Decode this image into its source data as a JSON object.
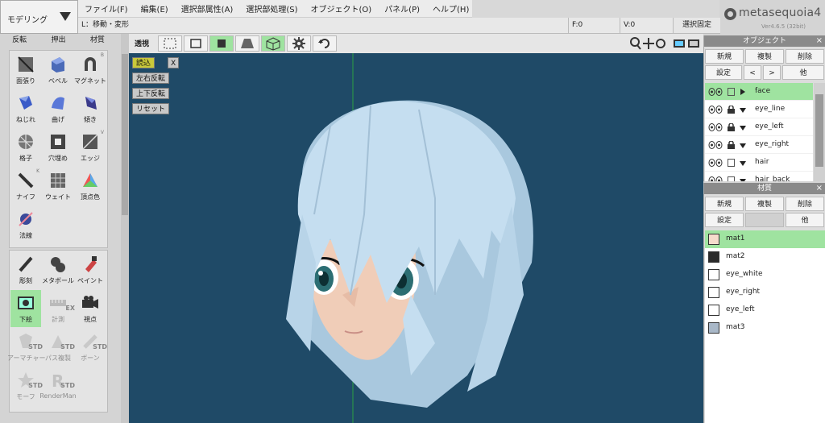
{
  "mode": {
    "label": "モデリング"
  },
  "menu": [
    "ファイル(F)",
    "編集(E)",
    "選択部属性(A)",
    "選択部処理(S)",
    "オブジェクト(O)",
    "パネル(P)",
    "ヘルプ(H)"
  ],
  "logo": {
    "name": "metasequoia",
    "version_num": "4",
    "version_text": "Ver4.6.5 (32bit)"
  },
  "status": {
    "hint": "L：移動・変形",
    "f": "F:0",
    "v": "V:0",
    "select_fix": "選択固定"
  },
  "left_tabs": [
    "反転",
    "押出",
    "材質"
  ],
  "tools_a": [
    {
      "name": "面張り",
      "icon": "face-fill-icon"
    },
    {
      "name": "ベベル",
      "icon": "bevel-icon"
    },
    {
      "name": "マグネット",
      "icon": "magnet-icon",
      "sup": "B"
    },
    {
      "name": "ねじれ",
      "icon": "twist-icon"
    },
    {
      "name": "曲げ",
      "icon": "bend-icon"
    },
    {
      "name": "傾き",
      "icon": "tilt-icon"
    },
    {
      "name": "格子",
      "icon": "lattice-icon"
    },
    {
      "name": "穴埋め",
      "icon": "hole-fill-icon"
    },
    {
      "name": "エッジ",
      "icon": "edge-icon",
      "sup": "V"
    },
    {
      "name": "ナイフ",
      "icon": "knife-icon",
      "sup": "K"
    },
    {
      "name": "ウェイト",
      "icon": "weight-icon"
    },
    {
      "name": "頂点色",
      "icon": "vertex-color-icon"
    },
    {
      "name": "法線",
      "icon": "normal-icon"
    }
  ],
  "tools_b": [
    {
      "name": "彫刻",
      "icon": "sculpt-icon"
    },
    {
      "name": "メタボール",
      "icon": "metaball-icon"
    },
    {
      "name": "ペイント",
      "icon": "paint-icon"
    },
    {
      "name": "下絵",
      "icon": "underlay-icon"
    },
    {
      "name": "計測",
      "icon": "measure-icon",
      "badge": "EX"
    },
    {
      "name": "視点",
      "icon": "camera-icon"
    },
    {
      "name": "アーマチャー",
      "icon": "armature-icon",
      "badge": "STD"
    },
    {
      "name": "パス複製",
      "icon": "path-clone-icon",
      "badge": "STD"
    },
    {
      "name": "ボーン",
      "icon": "bone-icon",
      "badge": "STD"
    },
    {
      "name": "モーフ",
      "icon": "morph-icon",
      "badge": "STD"
    },
    {
      "name": "RenderMan",
      "icon": "renderman-icon",
      "badge": "STD"
    }
  ],
  "viewport": {
    "label": "透視",
    "buttons": [
      "読込",
      "左右反転",
      "上下反転",
      "リセット"
    ],
    "close": "X"
  },
  "object_panel": {
    "title": "オブジェクト",
    "close": "×",
    "row1": [
      "新規",
      "複製",
      "削除"
    ],
    "row2": [
      "設定",
      "<",
      ">",
      "他"
    ],
    "objects": [
      {
        "name": "face",
        "locked": false,
        "expanded": false
      },
      {
        "name": "eye_line",
        "locked": true,
        "expanded": true
      },
      {
        "name": "eye_left",
        "locked": true,
        "expanded": true
      },
      {
        "name": "eye_right",
        "locked": true,
        "expanded": true
      },
      {
        "name": "hair",
        "locked": false,
        "expanded": true
      },
      {
        "name": "hair_back",
        "locked": false,
        "expanded": true
      }
    ]
  },
  "material_panel": {
    "title": "材質",
    "close": "×",
    "row1": [
      "新規",
      "複製",
      "削除"
    ],
    "row2": [
      "設定",
      "他"
    ],
    "materials": [
      {
        "name": "mat1",
        "color": "#f6dccd"
      },
      {
        "name": "mat2",
        "color": "#2a2a2a"
      },
      {
        "name": "eye_white",
        "color": "#ffffff"
      },
      {
        "name": "eye_right",
        "color": "#ffffff"
      },
      {
        "name": "eye_left",
        "color": "#ffffff"
      },
      {
        "name": "mat3",
        "color": "#a9b8c8"
      }
    ]
  },
  "colors": {
    "accent": "#9fe3a0",
    "viewport_bg": "#1f4a67",
    "hair": "#c5def0",
    "skin": "#f0cdb8"
  }
}
